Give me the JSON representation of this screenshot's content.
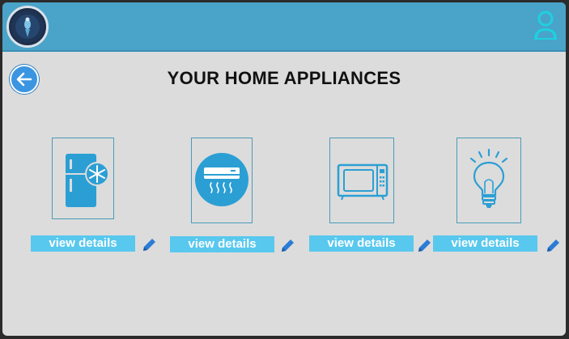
{
  "header": {
    "logo": "team-logo",
    "user_icon": "user-icon"
  },
  "page": {
    "title": "YOUR HOME APPLIANCES",
    "back_icon": "arrow-left-icon"
  },
  "appliances": [
    {
      "icon": "refrigerator-icon",
      "button_label": "view details",
      "edit_icon": "pencil-icon"
    },
    {
      "icon": "air-conditioner-icon",
      "button_label": "view details",
      "edit_icon": "pencil-icon"
    },
    {
      "icon": "microwave-icon",
      "button_label": "view details",
      "edit_icon": "pencil-icon"
    },
    {
      "icon": "light-bulb-icon",
      "button_label": "view details",
      "edit_icon": "pencil-icon"
    }
  ],
  "colors": {
    "header": "#4aa3c9",
    "background": "#dcdcdc",
    "button": "#58c8ee",
    "icon": "#2b9fd4",
    "edit": "#2a7cd6"
  }
}
